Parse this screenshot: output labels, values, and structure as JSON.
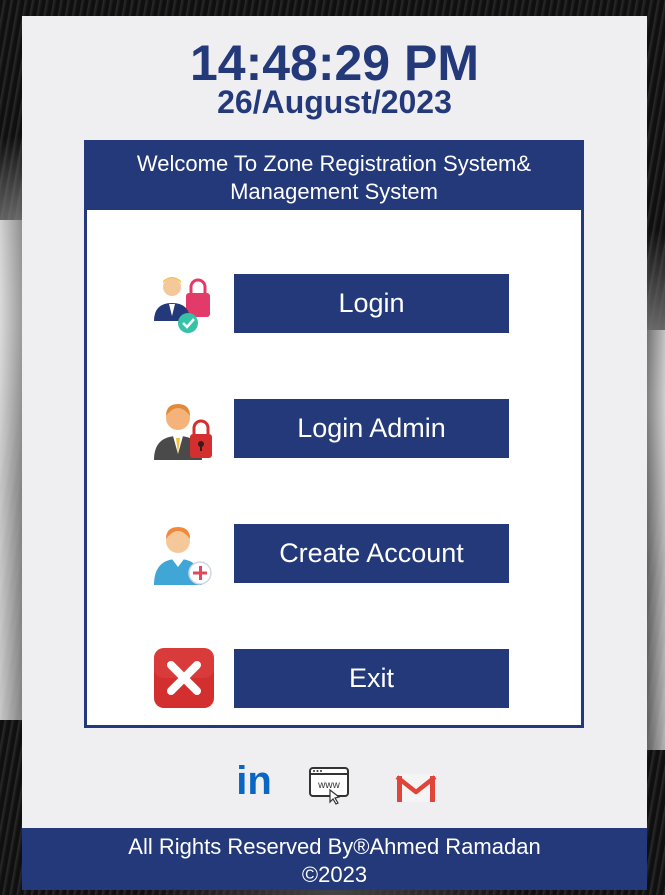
{
  "header": {
    "time": "14:48:29 PM",
    "date": "26/August/2023"
  },
  "box": {
    "title_line1": "Welcome To Zone Registration System&",
    "title_line2": "Management System"
  },
  "buttons": {
    "login": "Login",
    "login_admin": "Login Admin",
    "create_account": "Create Account",
    "exit": "Exit"
  },
  "icons": {
    "login": "user-check-lock-icon",
    "login_admin": "admin-lock-icon",
    "create_account": "user-add-icon",
    "exit": "close-icon"
  },
  "social": {
    "linkedin": "in",
    "website": "www",
    "email": "M"
  },
  "footer": {
    "line1": "All Rights Reserved By®Ahmed Ramadan",
    "line2": "©2023"
  },
  "colors": {
    "primary": "#24397a",
    "panel": "#efeff2",
    "exit_red": "#d32f2f",
    "linkedin": "#0a66c2"
  }
}
